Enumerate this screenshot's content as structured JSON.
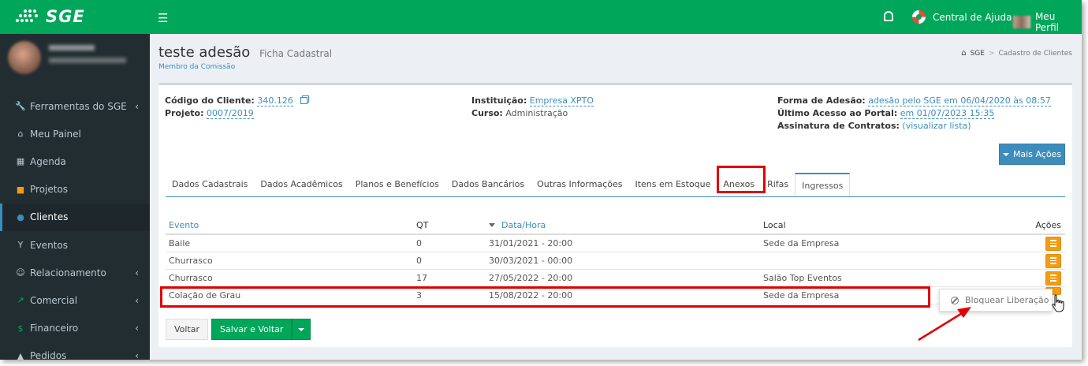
{
  "topbar": {
    "brand": "SGE",
    "help_label": "Central de Ajuda",
    "profile_label": "Meu Perfil",
    "color": "#00a65a"
  },
  "sidebar": {
    "items": [
      {
        "label": "Ferramentas do SGE",
        "icon": "wrench-icon",
        "chevron": true
      },
      {
        "label": "Meu Painel",
        "icon": "home-icon",
        "chevron": false
      },
      {
        "label": "Agenda",
        "icon": "calendar-icon",
        "chevron": false
      },
      {
        "label": "Projetos",
        "icon": "folder-icon",
        "chevron": false
      },
      {
        "label": "Clientes",
        "icon": "user-icon",
        "chevron": false,
        "active": true
      },
      {
        "label": "Eventos",
        "icon": "funnel-icon",
        "chevron": false
      },
      {
        "label": "Relacionamento",
        "icon": "smile-icon",
        "chevron": true
      },
      {
        "label": "Comercial",
        "icon": "chart-icon",
        "chevron": true
      },
      {
        "label": "Financeiro",
        "icon": "dollar-icon",
        "chevron": true
      },
      {
        "label": "Pedidos",
        "icon": "cart-icon",
        "chevron": true
      }
    ]
  },
  "page": {
    "title": "teste adesão",
    "subtitle": "Ficha Cadastral",
    "tag": "Membro da Comissão",
    "breadcrumb": [
      "SGE",
      "Cadastro de Clientes"
    ]
  },
  "client_info": {
    "codigo_label": "Código do Cliente:",
    "codigo_value": "340.126",
    "projeto_label": "Projeto:",
    "projeto_value": "0007/2019",
    "instituicao_label": "Instituição:",
    "instituicao_value": "Empresa XPTO",
    "curso_label": "Curso:",
    "curso_value": "Administração",
    "forma_label": "Forma de Adesão:",
    "forma_value": "adesão pelo SGE em 06/04/2020 às 08:57",
    "acesso_label": "Último Acesso ao Portal:",
    "acesso_value": "em 01/07/2023 15:35",
    "assinatura_label": "Assinatura de Contratos:",
    "assinatura_value": "(visualizar lista)"
  },
  "mais_acoes_label": "Mais Ações",
  "tabs": [
    "Dados Cadastrais",
    "Dados Acadêmicos",
    "Planos e Benefícios",
    "Dados Bancários",
    "Outras Informações",
    "Itens em Estoque",
    "Anexos",
    "Rifas",
    "Ingressos"
  ],
  "active_tab": "Ingressos",
  "grid": {
    "headers": {
      "evento": "Evento",
      "qt": "QT",
      "data": "Data/Hora",
      "local": "Local",
      "acoes": "Ações"
    },
    "rows": [
      {
        "evento": "Baile",
        "qt": "0",
        "data": "31/01/2021 - 20:00",
        "local": "Sede da Empresa"
      },
      {
        "evento": "Churrasco",
        "qt": "0",
        "data": "30/03/2021 - 00:00",
        "local": ""
      },
      {
        "evento": "Churrasco",
        "qt": "17",
        "data": "27/05/2022 - 20:00",
        "local": "Salão Top Eventos"
      },
      {
        "evento": "Colação de Grau",
        "qt": "3",
        "data": "15/08/2022 - 20:00",
        "local": "Sede da Empresa"
      }
    ]
  },
  "buttons": {
    "voltar": "Voltar",
    "salvar_voltar": "Salvar e Voltar"
  },
  "dropdown": {
    "bloquear": "Bloquear Liberação"
  },
  "colors": {
    "primary": "#3c8dbc",
    "success": "#00a65a",
    "warning": "#f39c12",
    "highlight": "#e00000",
    "sidebar": "#222d32"
  }
}
